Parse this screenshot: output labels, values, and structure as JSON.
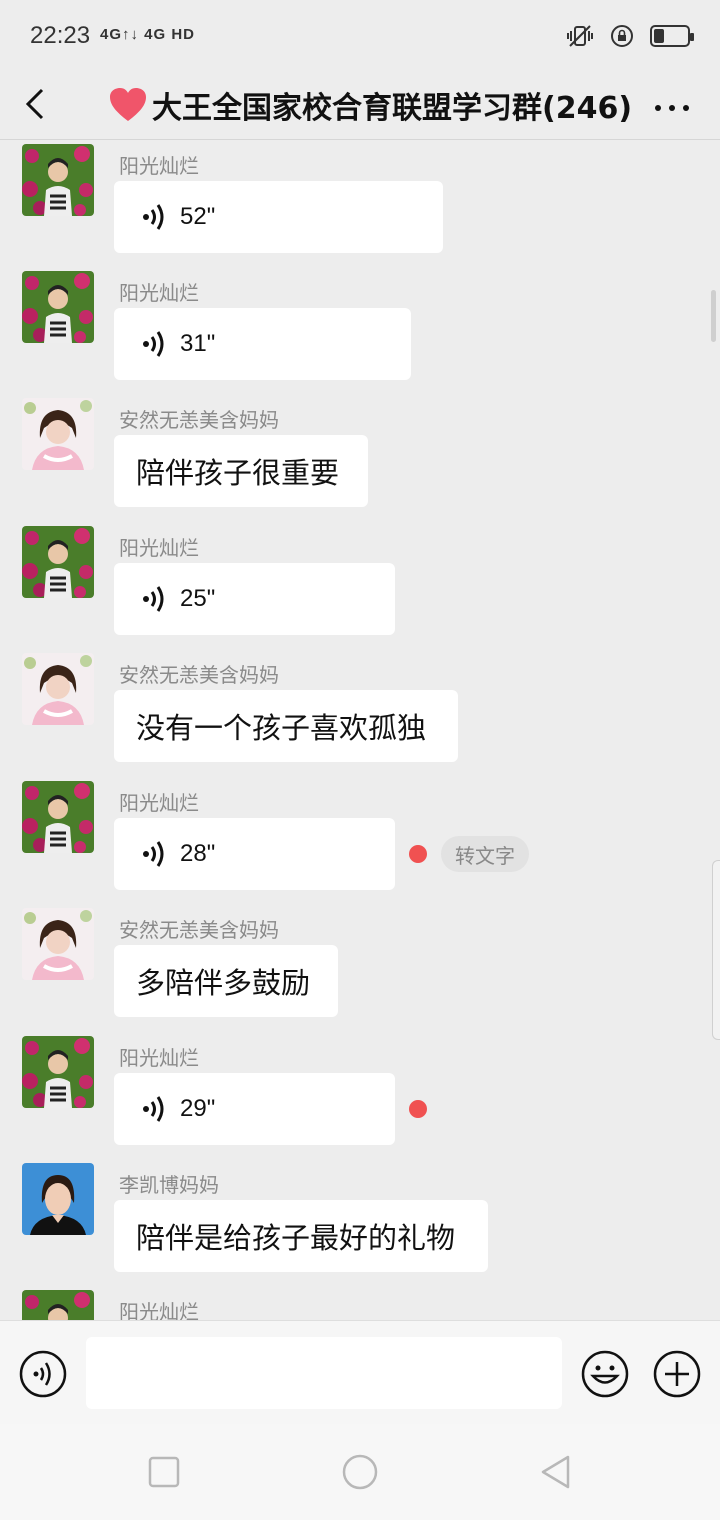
{
  "status_bar": {
    "time": "22:23",
    "signal_text": "4G↑↓ 4G HD",
    "battery_level": 0.3
  },
  "header": {
    "title": "大王全国家校合育联盟学习群(246)",
    "heart_color": "#f0556a"
  },
  "messages": [
    {
      "sender": "阳光灿烂",
      "type": "voice",
      "duration": "52\"",
      "avatar": "flowers-avatar"
    },
    {
      "sender": "阳光灿烂",
      "type": "voice",
      "duration": "31\"",
      "avatar": "flowers-avatar"
    },
    {
      "sender": "安然无恙美含妈妈",
      "type": "text",
      "text": "陪伴孩子很重要",
      "avatar": "girl-avatar"
    },
    {
      "sender": "阳光灿烂",
      "type": "voice",
      "duration": "25\"",
      "avatar": "flowers-avatar"
    },
    {
      "sender": "安然无恙美含妈妈",
      "type": "text",
      "text": "没有一个孩子喜欢孤独",
      "avatar": "girl-avatar"
    },
    {
      "sender": "阳光灿烂",
      "type": "voice",
      "duration": "28\"",
      "avatar": "flowers-avatar",
      "unread": true,
      "transcribe_label": "转文字"
    },
    {
      "sender": "安然无恙美含妈妈",
      "type": "text",
      "text": "多陪伴多鼓励",
      "avatar": "girl-avatar"
    },
    {
      "sender": "阳光灿烂",
      "type": "voice",
      "duration": "29\"",
      "avatar": "flowers-avatar",
      "unread": true
    },
    {
      "sender": "李凯博妈妈",
      "type": "text",
      "text": "陪伴是给孩子最好的礼物",
      "avatar": "portrait-avatar"
    },
    {
      "sender": "阳光灿烂",
      "type": "partial",
      "avatar": "flowers-avatar"
    }
  ],
  "input_bar": {
    "value": "",
    "placeholder": ""
  },
  "colors": {
    "background": "#ededed",
    "bubble": "#ffffff",
    "unread_dot": "#f05151"
  }
}
